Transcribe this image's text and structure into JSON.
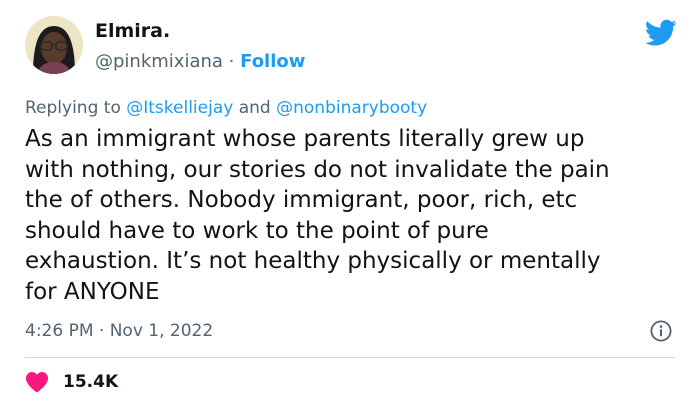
{
  "author": {
    "name": "Elmira.",
    "handle": "@pinkmixiana",
    "separator": "·",
    "follow_label": "Follow"
  },
  "reply": {
    "prefix": "Replying to",
    "mentions": [
      "@Itskelliejay",
      "@nonbinarybooty"
    ],
    "conjunction": "and"
  },
  "tweet": {
    "text": "As an immigrant whose parents literally grew up\nwith nothing, our stories do not invalidate the pain\nthe of others. Nobody immigrant, poor, rich, etc\nshould have to work to the point of pure\nexhaustion. It’s not healthy physically or mentally\nfor ANYONE"
  },
  "meta": {
    "time": "4:26 PM",
    "separator": "·",
    "date": "Nov 1, 2022"
  },
  "engagement": {
    "like_count": "15.4K"
  },
  "icons": {
    "brand": "twitter-bird-icon",
    "info": "info-icon",
    "like": "heart-icon"
  },
  "colors": {
    "accent": "#1d9bf0",
    "heart": "#f91880",
    "muted": "#536471",
    "text": "#0f1419"
  }
}
